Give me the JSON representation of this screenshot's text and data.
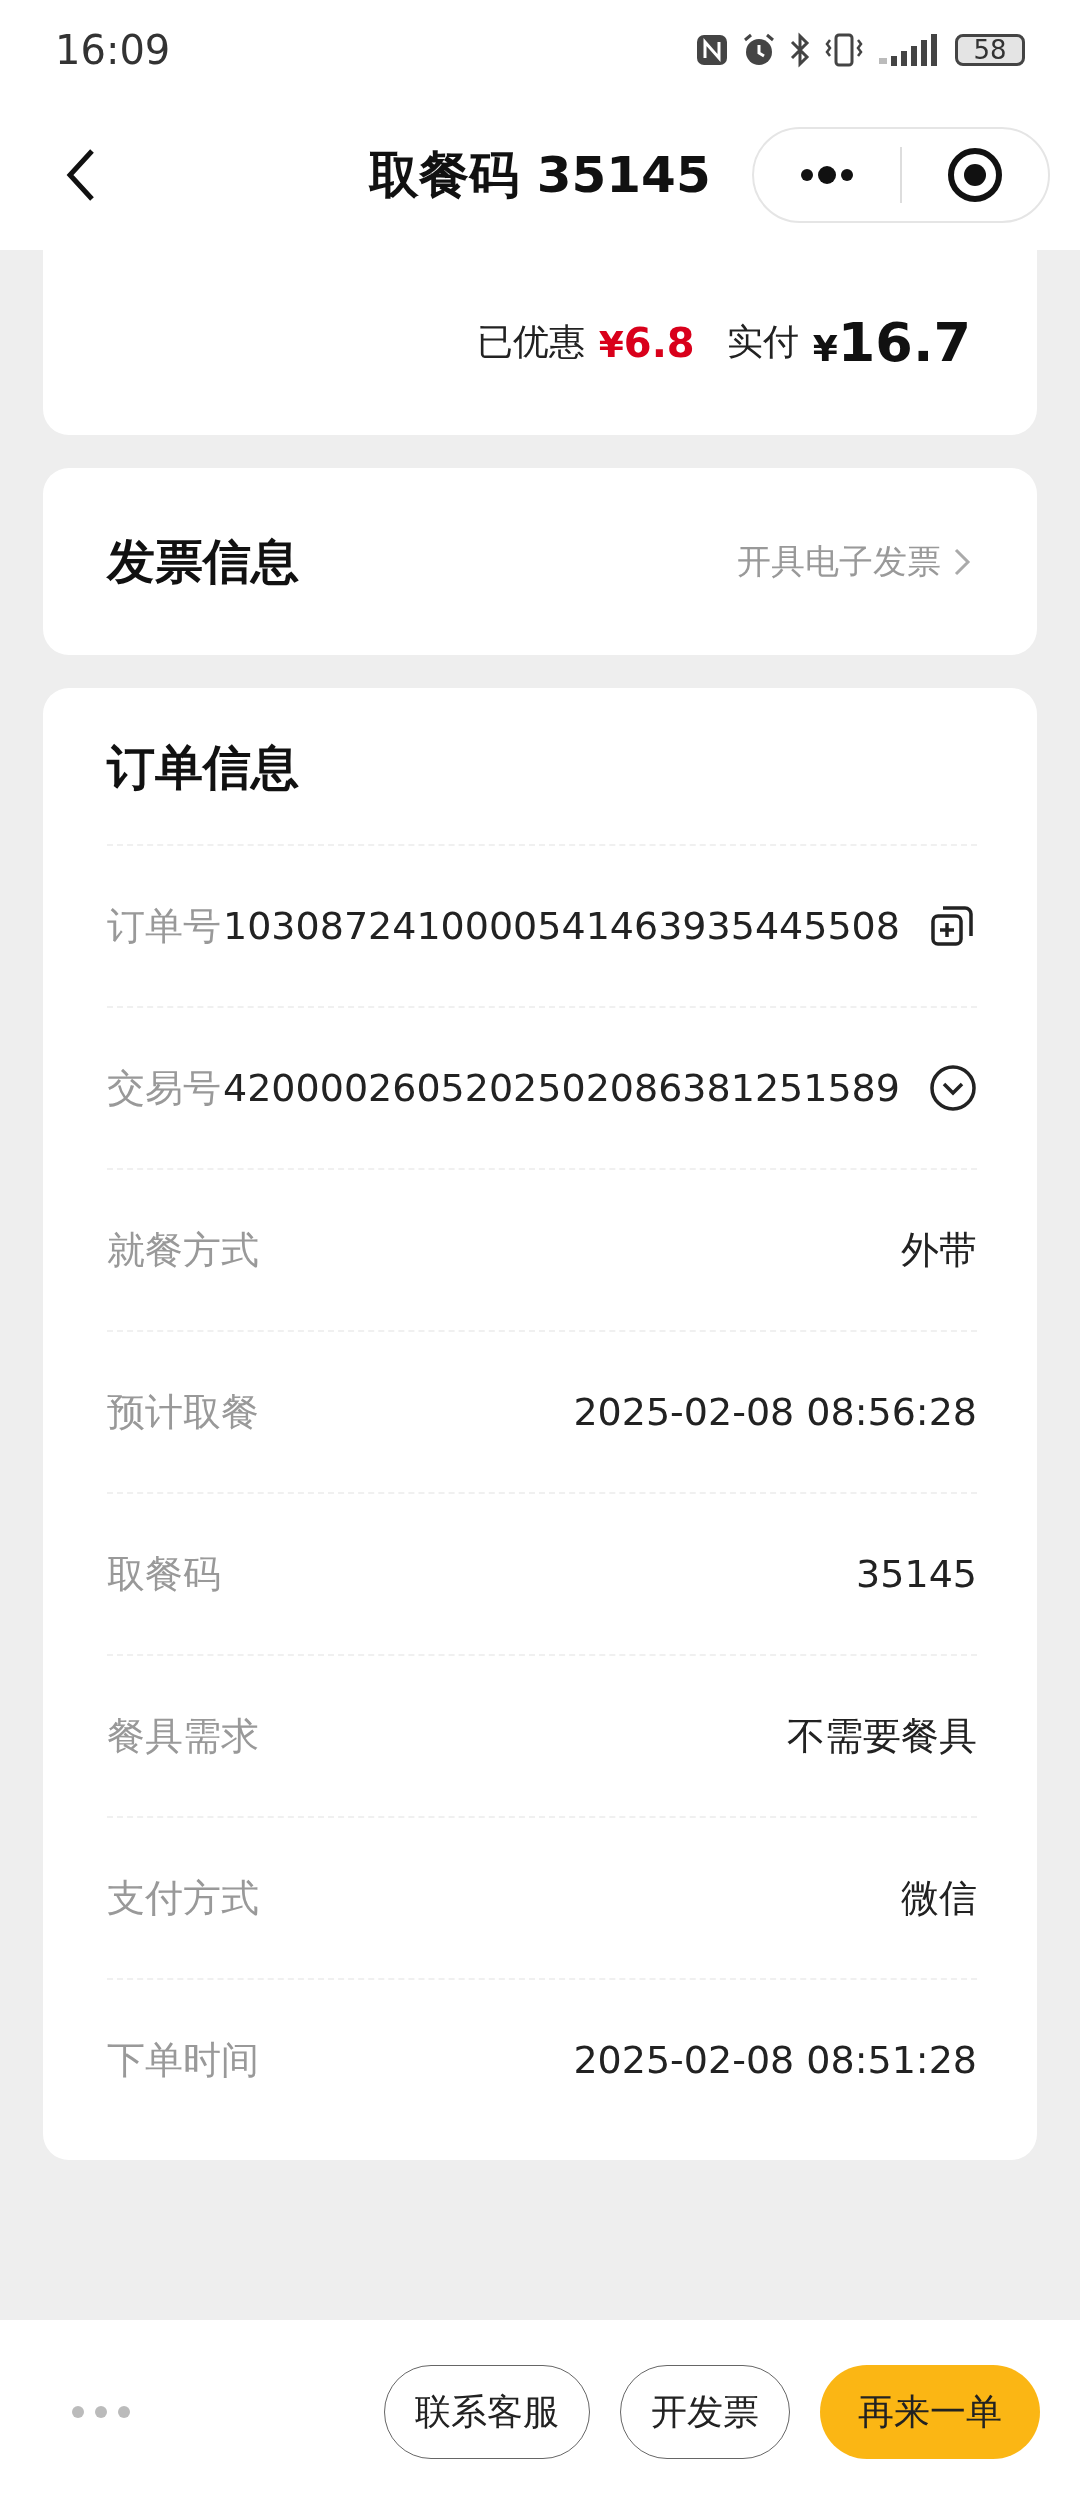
{
  "status_bar": {
    "time": "16:09",
    "battery": "58"
  },
  "header": {
    "title": "取餐码 35145"
  },
  "price_summary": {
    "discount_label": "已优惠",
    "discount_currency": "¥",
    "discount_amount": "6.8",
    "paid_label": "实付",
    "paid_currency": "¥",
    "paid_amount": "16.7"
  },
  "invoice": {
    "title": "发票信息",
    "action": "开具电子发票"
  },
  "order_info": {
    "title": "订单信息",
    "rows": [
      {
        "kind": "copy",
        "label": "订单号",
        "value": "1030872410000541463935445508"
      },
      {
        "kind": "expand",
        "label": "交易号",
        "value": "4200002605202502086381251589"
      },
      {
        "kind": "plain",
        "label": "就餐方式",
        "value": "外带"
      },
      {
        "kind": "plain",
        "label": "预计取餐",
        "value": "2025-02-08 08:56:28"
      },
      {
        "kind": "plain",
        "label": "取餐码",
        "value": "35145"
      },
      {
        "kind": "plain",
        "label": "餐具需求",
        "value": "不需要餐具"
      },
      {
        "kind": "plain",
        "label": "支付方式",
        "value": "微信"
      },
      {
        "kind": "plain",
        "label": "下单时间",
        "value": "2025-02-08 08:51:28"
      }
    ]
  },
  "bottom_bar": {
    "buttons": [
      {
        "label": "联系客服",
        "primary": false
      },
      {
        "label": "开发票",
        "primary": false
      },
      {
        "label": "再来一单",
        "primary": true
      }
    ]
  }
}
